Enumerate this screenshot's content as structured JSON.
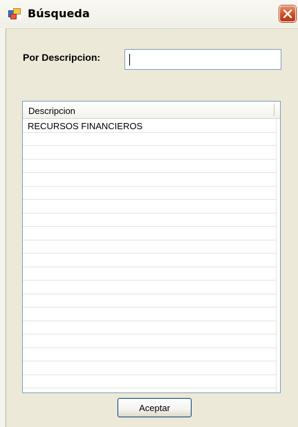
{
  "window": {
    "title": "Búsqueda",
    "icon": "form-window-icon",
    "close_icon": "close-icon",
    "close_color": "#c9482a"
  },
  "search": {
    "label": "Por Descripcion:",
    "value": "",
    "placeholder": ""
  },
  "grid": {
    "columns": [
      "Descripcion"
    ],
    "rows": [
      [
        "RECURSOS FINANCIEROS"
      ],
      [
        ""
      ],
      [
        ""
      ],
      [
        ""
      ],
      [
        ""
      ],
      [
        ""
      ],
      [
        ""
      ],
      [
        ""
      ],
      [
        ""
      ],
      [
        ""
      ],
      [
        ""
      ],
      [
        ""
      ],
      [
        ""
      ],
      [
        ""
      ],
      [
        ""
      ],
      [
        ""
      ],
      [
        ""
      ],
      [
        ""
      ],
      [
        ""
      ],
      [
        ""
      ]
    ]
  },
  "footer": {
    "accept_label": "Aceptar"
  }
}
